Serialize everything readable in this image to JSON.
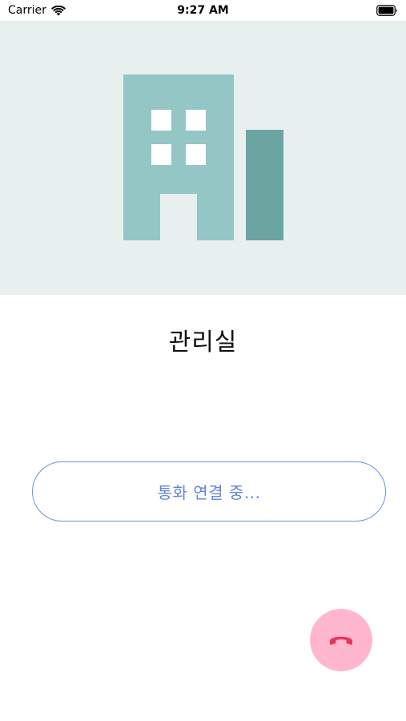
{
  "status_bar": {
    "carrier": "Carrier",
    "time": "9:27 AM"
  },
  "contact": {
    "name": "관리실"
  },
  "call": {
    "status": "통화 연결 중..."
  },
  "colors": {
    "hero_bg": "#e7f0ef",
    "building_main": "#93c6c4",
    "building_side": "#6ba5a2",
    "pill_border": "#6f8fe6",
    "pill_text": "#5f84e0",
    "end_button_bg": "#ffb7cf",
    "hangup_icon": "#e8365f"
  },
  "icons": {
    "wifi": "wifi-icon",
    "battery": "battery-icon",
    "building": "building-icon",
    "hangup": "phone-hangup-icon"
  }
}
